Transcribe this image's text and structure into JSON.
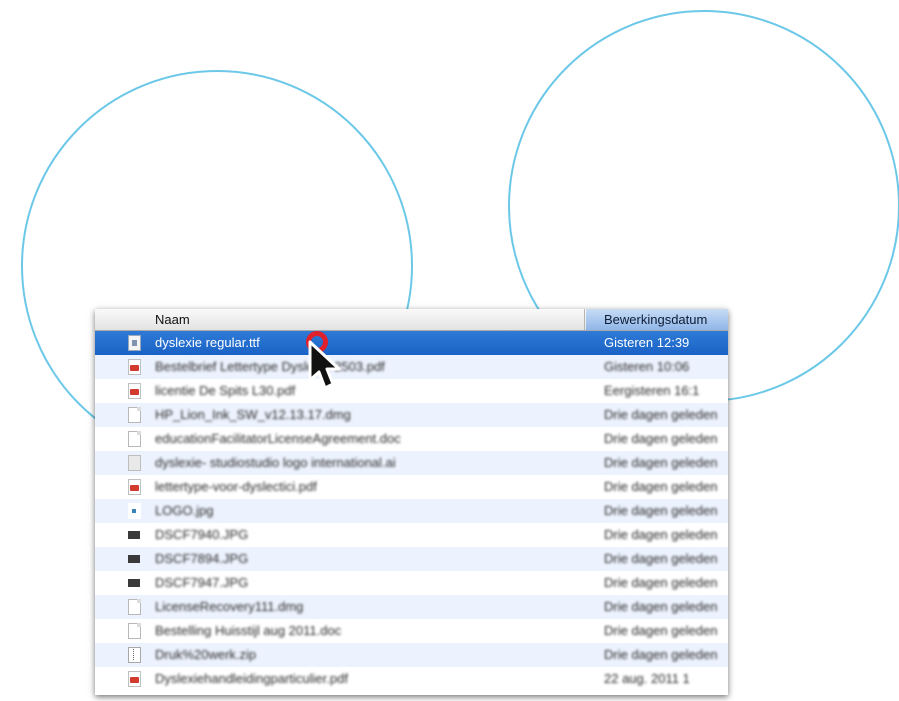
{
  "finder": {
    "columns": {
      "name": "Naam",
      "date": "Bewerkingsdatum"
    },
    "files": [
      {
        "name": "dyslexie regular.ttf",
        "date": "Gisteren 12:39",
        "icon": "font-file-icon",
        "selected": true
      },
      {
        "name": "Bestelbrief Lettertype Dyslexie 2503.pdf",
        "date": "Gisteren 10:06",
        "icon": "pdf-file-icon"
      },
      {
        "name": "licentie De Spits L30.pdf",
        "date": "Eergisteren 16:1",
        "icon": "pdf-file-icon"
      },
      {
        "name": "HP_Lion_Ink_SW_v12.13.17.dmg",
        "date": "Drie dagen geleden",
        "icon": "document-icon"
      },
      {
        "name": "educationFacilitatorLicenseAgreement.doc",
        "date": "Drie dagen geleden",
        "icon": "document-icon"
      },
      {
        "name": "dyslexie- studiostudio logo international.ai",
        "date": "Drie dagen geleden",
        "icon": "illustrator-file-icon"
      },
      {
        "name": "lettertype-voor-dyslectici.pdf",
        "date": "Drie dagen geleden",
        "icon": "pdf-file-icon"
      },
      {
        "name": "LOGO.jpg",
        "date": "Drie dagen geleden",
        "icon": "jpg-image-icon"
      },
      {
        "name": "DSCF7940.JPG",
        "date": "Drie dagen geleden",
        "icon": "photo-icon"
      },
      {
        "name": "DSCF7894.JPG",
        "date": "Drie dagen geleden",
        "icon": "photo-icon"
      },
      {
        "name": "DSCF7947.JPG",
        "date": "Drie dagen geleden",
        "icon": "photo-icon"
      },
      {
        "name": "LicenseRecovery111.dmg",
        "date": "Drie dagen geleden",
        "icon": "document-icon"
      },
      {
        "name": "Bestelling Huisstijl aug 2011.doc",
        "date": "Drie dagen geleden",
        "icon": "document-icon"
      },
      {
        "name": "Druk%20werk.zip",
        "date": "Drie dagen geleden",
        "icon": "zip-archive-icon"
      },
      {
        "name": "Dyslexiehandleidingparticulier.pdf",
        "date": "22 aug. 2011 1",
        "icon": "pdf-file-icon"
      }
    ]
  },
  "colors": {
    "circle_stroke": "#6cc8e8",
    "selection": "#1a63c6",
    "cursor_mark": "#e0202a",
    "alt_row": "#edf3fe"
  },
  "icons": {
    "pointer": "arrow-cursor-icon",
    "click_marker": "click-highlight-ring"
  }
}
